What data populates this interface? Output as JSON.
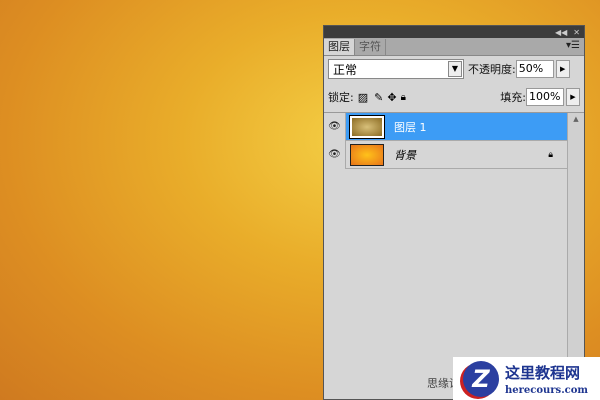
{
  "panel": {
    "tabs": [
      "图层",
      "字符"
    ],
    "blend_mode": "正常",
    "opacity_label": "不透明度:",
    "opacity": "50%",
    "lock_label": "锁定:",
    "fill_label": "填充:",
    "fill": "100%"
  },
  "layers": [
    {
      "name": "图层 1",
      "selected": true
    },
    {
      "name": "背景",
      "locked": true
    }
  ],
  "footer_text": "思缘设计",
  "watermark": {
    "logo": "Z",
    "title": "这里教程网",
    "url": "herecours.com"
  }
}
